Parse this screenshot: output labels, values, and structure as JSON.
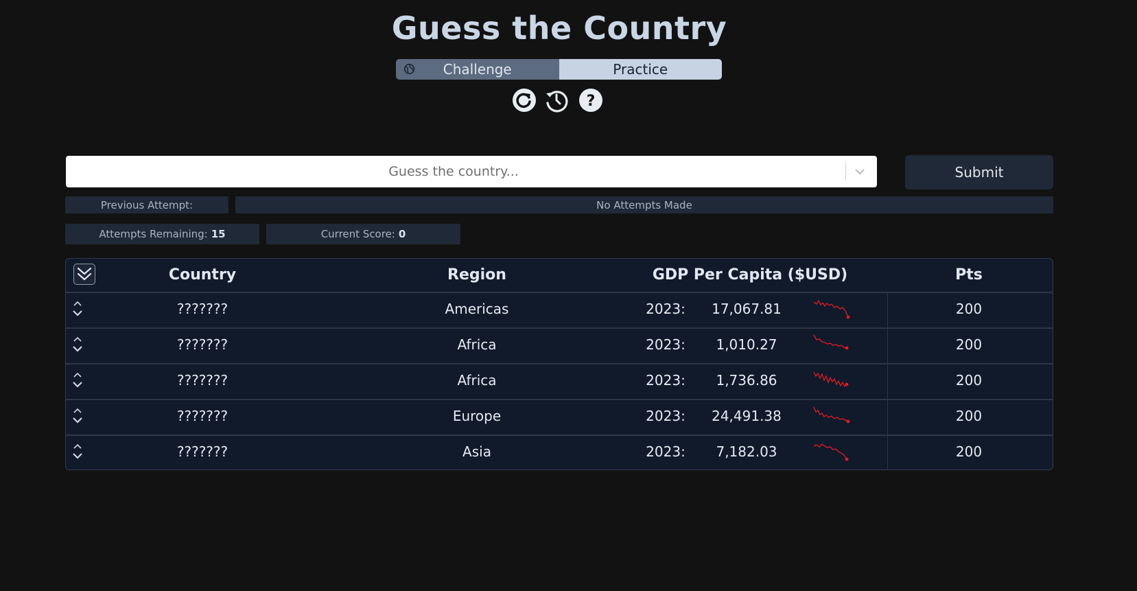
{
  "title": "Guess the Country",
  "mode": {
    "challenge_label": "Challenge",
    "practice_label": "Practice",
    "active": "practice"
  },
  "toolbar": {
    "icons": [
      "refresh-icon",
      "history-icon",
      "help-icon"
    ]
  },
  "guess": {
    "placeholder": "Guess the country...",
    "submit_label": "Submit"
  },
  "status": {
    "previous_label": "Previous Attempt:",
    "previous_value": "No Attempts Made",
    "attempts_label": "Attempts Remaining:",
    "attempts_value": "15",
    "score_label": "Current Score:",
    "score_value": "0"
  },
  "table": {
    "headers": {
      "country": "Country",
      "region": "Region",
      "gdp": "GDP Per Capita ($USD)",
      "pts": "Pts"
    },
    "rows": [
      {
        "country": "???????",
        "region": "Americas",
        "year": "2023:",
        "gdp": "17,067.81",
        "pts": "200"
      },
      {
        "country": "???????",
        "region": "Africa",
        "year": "2023:",
        "gdp": "1,010.27",
        "pts": "200"
      },
      {
        "country": "???????",
        "region": "Africa",
        "year": "2023:",
        "gdp": "1,736.86",
        "pts": "200"
      },
      {
        "country": "???????",
        "region": "Europe",
        "year": "2023:",
        "gdp": "24,491.38",
        "pts": "200"
      },
      {
        "country": "???????",
        "region": "Asia",
        "year": "2023:",
        "gdp": "7,182.03",
        "pts": "200"
      }
    ]
  },
  "colors": {
    "background": "#121212",
    "panel": "#1f2937",
    "table": "#111a2b",
    "sparkline": "#e01b24"
  }
}
